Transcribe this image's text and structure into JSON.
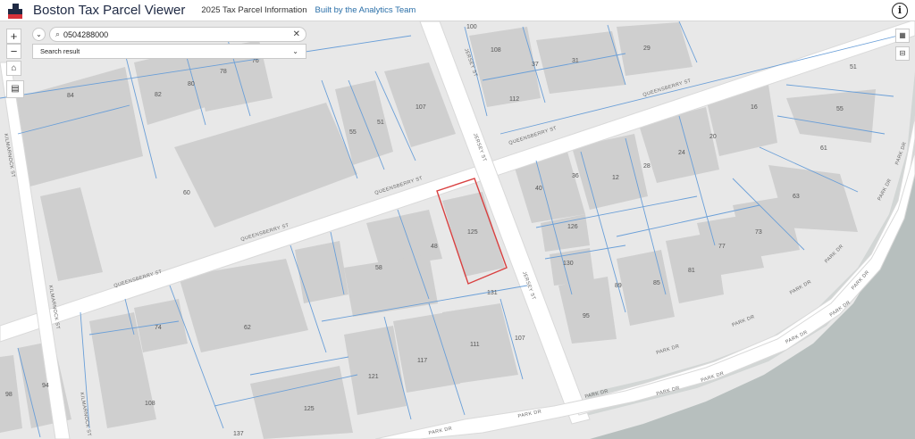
{
  "header": {
    "title": "Boston Tax Parcel Viewer",
    "subtitle": "2025 Tax Parcel Information",
    "credit": "Built by the Analytics Team",
    "info_glyph": "i"
  },
  "controls": {
    "zoom_in": "+",
    "zoom_out": "−",
    "home_glyph": "⌂",
    "basemap_glyph": "▤",
    "qr_glyph": "▦",
    "measure_glyph": "⊟"
  },
  "search": {
    "value": "0504288000",
    "result_label": "Search result",
    "collapse_glyph": "⌄",
    "clear_glyph": "✕",
    "icons": [
      "search-icon",
      "chevron-down-icon",
      "close-icon"
    ]
  },
  "colors": {
    "parcel_line": "#6a9fd8",
    "selected_parcel": "#d94040",
    "building": "#cfcfcf",
    "road": "#ffffff",
    "water": "#b7bfbe"
  },
  "parcel_labels": [
    "100",
    "108",
    "37",
    "31",
    "29",
    "84",
    "82",
    "80",
    "78",
    "76",
    "55",
    "51",
    "107",
    "112",
    "16",
    "20",
    "24",
    "28",
    "12",
    "36",
    "40",
    "61",
    "63",
    "60",
    "48",
    "125",
    "126",
    "130",
    "77",
    "73",
    "89",
    "85",
    "81",
    "95",
    "74",
    "62",
    "58",
    "131",
    "111",
    "117",
    "121",
    "107",
    "94",
    "98",
    "108",
    "125",
    "137",
    "51",
    "55"
  ],
  "street_labels": [
    "QUEENSBERRY ST",
    "QUEENSBERRY ST",
    "QUEENSBERRY ST",
    "QUEENSBERRY ST",
    "QUEENSBERRY ST",
    "JERSEY ST",
    "JERSEY ST",
    "JERSEY ST",
    "KILMARNOCK ST",
    "KILMARNOCK ST",
    "KILMARNOCK ST",
    "PARK DR",
    "PARK DR",
    "PARK DR",
    "PARK DR",
    "PARK DR",
    "PARK DR",
    "PARK DR",
    "PARK DR",
    "PARK DR",
    "PARK DR",
    "PARK DR",
    "PARK DR",
    "PARK DR",
    "PARK DR"
  ]
}
